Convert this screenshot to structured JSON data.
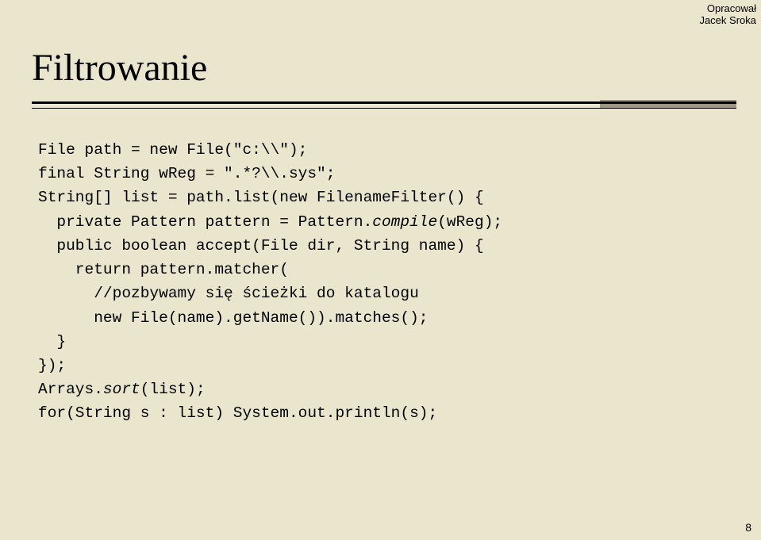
{
  "author": {
    "line1": "Opracował",
    "line2": "Jacek Sroka"
  },
  "title": "Filtrowanie",
  "code": {
    "l1": "File path = new File(\"c:\\\\\");",
    "l2": "final String wReg = \".*?\\\\.sys\";",
    "l3": "String[] list = path.list(new FilenameFilter() {",
    "l4": "  private Pattern pattern = Pattern.",
    "l4i": "compile",
    "l4b": "(wReg);",
    "l5": "  public boolean accept(File dir, String name) {",
    "l6": "    return pattern.matcher(",
    "l7": "      //pozbywamy się ścieżki do katalogu",
    "l8": "      new File(name).getName()).matches();",
    "l9": "  }",
    "l10": "});",
    "l11": "Arrays.",
    "l11i": "sort",
    "l11b": "(list);",
    "l12": "for(String s : list) System.out.println(s);"
  },
  "pagenum": "8"
}
